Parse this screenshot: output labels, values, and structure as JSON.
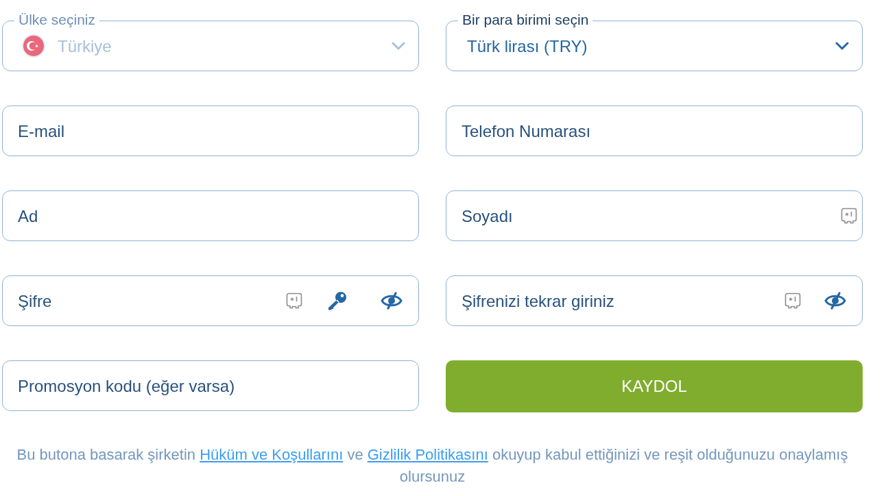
{
  "selects": [
    {
      "kind": "country",
      "label": "Ülke seçiniz",
      "value": "Türkiye",
      "disabled": true
    },
    {
      "kind": "currency",
      "label": "Bir para birimi seçin",
      "value": "Türk lirası (TRY)",
      "disabled": false
    }
  ],
  "fields": [
    {
      "kind": "text",
      "placeholder": "E-mail",
      "autofill_icon": false
    },
    {
      "kind": "text",
      "placeholder": "Telefon Numarası",
      "autofill_icon": false
    },
    {
      "kind": "text",
      "placeholder": "Ad",
      "autofill_icon": false
    },
    {
      "kind": "text",
      "placeholder": "Soyadı",
      "autofill_icon": true
    },
    {
      "kind": "password",
      "placeholder": "Şifre",
      "autofill_icon": true,
      "key_icon": true,
      "masked": true
    },
    {
      "kind": "password",
      "placeholder": "Şifrenizi tekrar giriniz",
      "autofill_icon": true,
      "key_icon": false,
      "masked": true
    },
    {
      "kind": "text",
      "placeholder": "Promosyon kodu (eğer varsa)",
      "autofill_icon": false
    }
  ],
  "submit_button": {
    "label": "KAYDOL"
  },
  "consent": {
    "parts": [
      {
        "kind": "text",
        "text": "Bu butona basarak şirketin "
      },
      {
        "kind": "link",
        "text": "Hüküm ve Koşullarını"
      },
      {
        "kind": "text",
        "text": " ve "
      },
      {
        "kind": "link",
        "text": "Gizlilik Politikasını"
      },
      {
        "kind": "text",
        "text": " okuyup kabul ettiğinizi ve reşit olduğunuzu onaylamış olursunuz"
      }
    ]
  }
}
